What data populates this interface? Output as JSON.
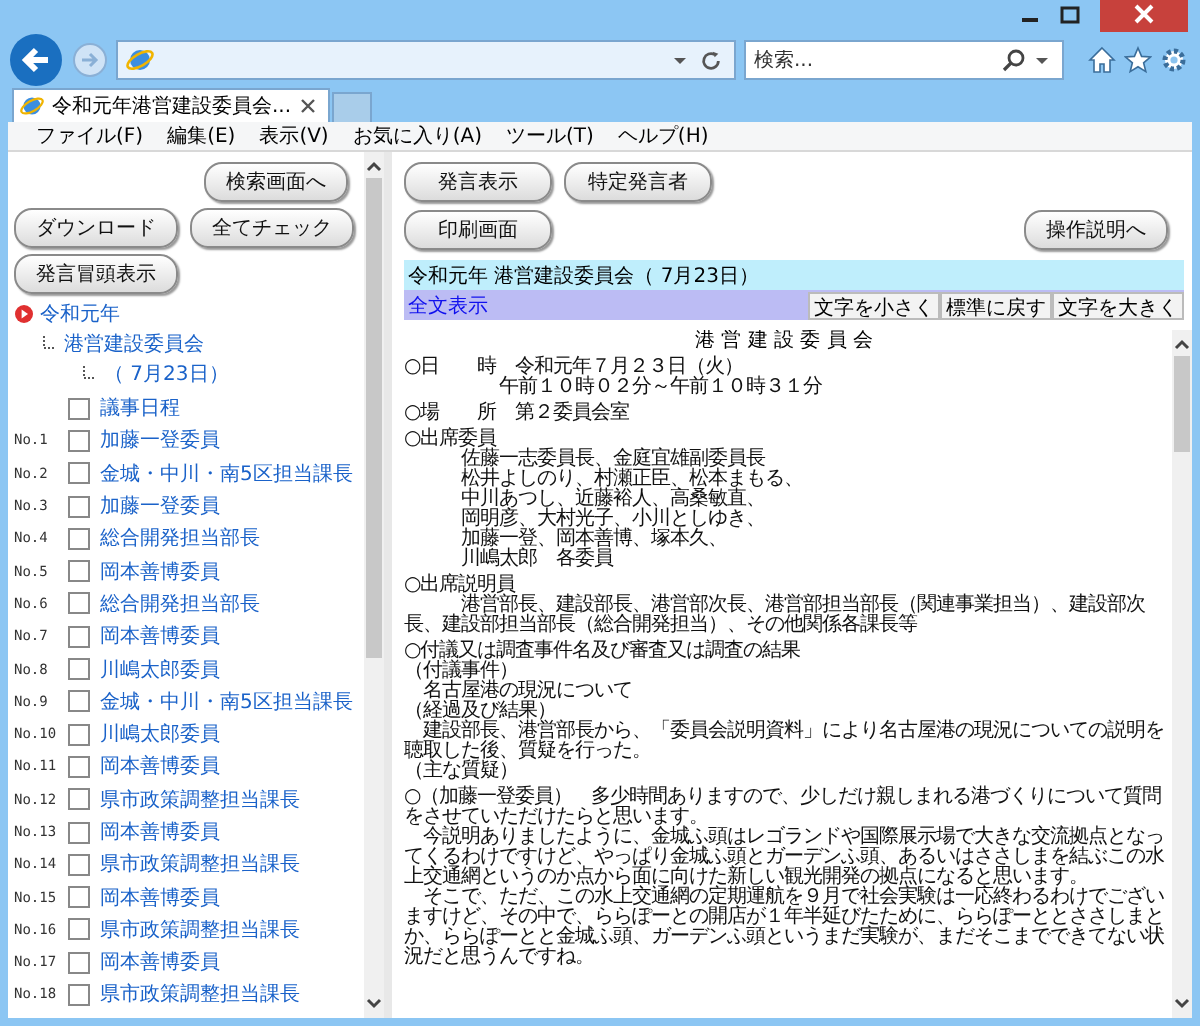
{
  "browser": {
    "search_placeholder": "検索...",
    "tab_title": "令和元年港営建設委員会...",
    "menu": [
      "ファイル(F)",
      "編集(E)",
      "表示(V)",
      "お気に入り(A)",
      "ツール(T)",
      "ヘルプ(H)"
    ]
  },
  "left_panel": {
    "search_button": "検索画面へ",
    "buttons": [
      "ダウンロード",
      "全てチェック"
    ],
    "headline_button": "発言冒頭表示",
    "tree": [
      {
        "label": "令和元年",
        "children": [
          {
            "label": "港営建設委員会",
            "children": [
              {
                "label": "（ 7月23日）"
              }
            ]
          }
        ]
      }
    ],
    "items": [
      {
        "label": "議事日程",
        "checked": false
      },
      {
        "number": "No.1",
        "label": "加藤一登委員",
        "checked": false
      },
      {
        "number": "No.2",
        "label": "金城・中川・南5区担当課長",
        "checked": false
      },
      {
        "number": "No.3",
        "label": "加藤一登委員",
        "checked": false
      },
      {
        "number": "No.4",
        "label": "総合開発担当部長",
        "checked": false
      },
      {
        "number": "No.5",
        "label": "岡本善博委員",
        "checked": false
      },
      {
        "number": "No.6",
        "label": "総合開発担当部長",
        "checked": false
      },
      {
        "number": "No.7",
        "label": "岡本善博委員",
        "checked": false
      },
      {
        "number": "No.8",
        "label": "川嶋太郎委員",
        "checked": false
      },
      {
        "number": "No.9",
        "label": "金城・中川・南5区担当課長",
        "checked": false
      },
      {
        "number": "No.10",
        "label": "川嶋太郎委員",
        "checked": false
      },
      {
        "number": "No.11",
        "label": "岡本善博委員",
        "checked": false
      },
      {
        "number": "No.12",
        "label": "県市政策調整担当課長",
        "checked": false
      },
      {
        "number": "No.13",
        "label": "岡本善博委員",
        "checked": false
      },
      {
        "number": "No.14",
        "label": "県市政策調整担当課長",
        "checked": false
      },
      {
        "number": "No.15",
        "label": "岡本善博委員",
        "checked": false
      },
      {
        "number": "No.16",
        "label": "県市政策調整担当課長",
        "checked": false
      },
      {
        "number": "No.17",
        "label": "岡本善博委員",
        "checked": false
      },
      {
        "number": "No.18",
        "label": "県市政策調整担当課長",
        "checked": false
      }
    ]
  },
  "right_panel": {
    "buttons": [
      "発言表示",
      "特定発言者"
    ],
    "print_button": "印刷画面",
    "help_button": "操作説明へ",
    "meeting_title": "令和元年 港営建設委員会（ 7月23日）",
    "full_text_link": "全文表示",
    "font_buttons": [
      "文字を小さく",
      "標準に戻す",
      "文字を大きく"
    ],
    "document": {
      "title": "港 営 建 設 委 員 会",
      "sections": [
        [
          "○日　　時　令和元年７月２３日（火）",
          "　　　　　午前１０時０２分～午前１０時３１分"
        ],
        [
          "○場　　所　第２委員会室"
        ],
        [
          "○出席委員",
          "　　　佐藤一志委員長、金庭宜雄副委員長",
          "　　　松井よしのり、村瀬正臣、松本まもる、",
          "　　　中川あつし、近藤裕人、高桑敏直、",
          "　　　岡明彦、大村光子、小川としゆき、",
          "　　　加藤一登、岡本善博、塚本久、",
          "　　　川嶋太郎　各委員"
        ],
        [
          "○出席説明員",
          "　　　港営部長、建設部長、港営部次長、港営部担当部長（関連事業担当）、建設部次長、建設部担当部長（総合開発担当）、その他関係各課長等"
        ],
        [
          "○付議又は調査事件名及び審査又は調査の結果",
          "（付議事件）",
          "　名古屋港の現況について",
          "（経過及び結果）",
          "　建設部長、港営部長から、「委員会説明資料」により名古屋港の現況についての説明を聴取した後、質疑を行った。",
          "（主な質疑）"
        ],
        [
          "○（加藤一登委員）　多少時間ありますので、少しだけ親しまれる港づくりについて質問をさせていただけたらと思います。",
          "　今説明ありましたように、金城ふ頭はレゴランドや国際展示場で大きな交流拠点となってくるわけですけど、やっぱり金城ふ頭とガーデンふ頭、あるいはささしまを結ぶこの水上交通網というのか点から面に向けた新しい観光開発の拠点になると思います。",
          "　そこで、ただ、この水上交通網の定期運航を９月で社会実験は一応終わるわけでございますけど、その中で、ららぽーとの開店が１年半延びたために、ららぽーととささしまとか、ららぽーとと金城ふ頭、ガーデンふ頭というまだ実験が、まだそこまでできてない状況だと思うんですね。"
        ]
      ]
    }
  }
}
